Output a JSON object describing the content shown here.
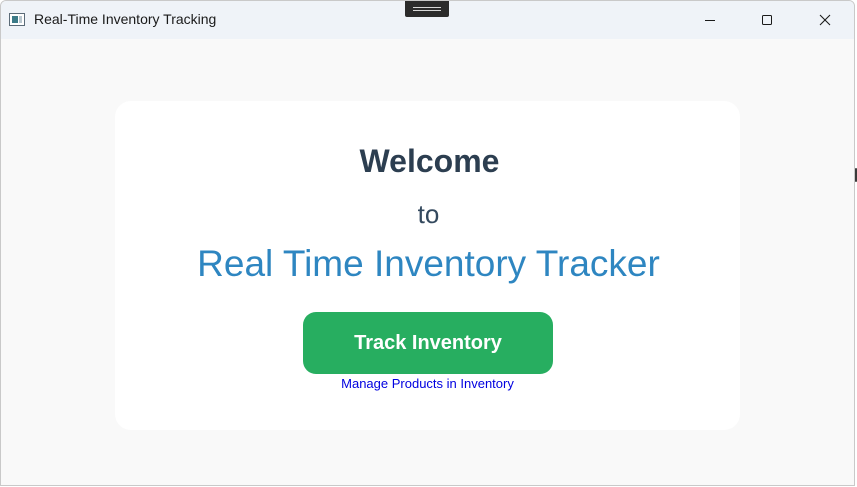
{
  "window": {
    "title": "Real-Time Inventory Tracking",
    "controls": {
      "minimize": "minimize-icon",
      "maximize": "maximize-icon",
      "close": "close-icon"
    }
  },
  "main": {
    "welcome": "Welcome",
    "to": "to",
    "app_name": "Real Time Inventory Tracker",
    "track_button_label": "Track Inventory",
    "manage_link": "Manage Products in Inventory"
  },
  "colors": {
    "heading": "#2c3e50",
    "accent_blue": "#2e86c1",
    "button_green": "#27ae60",
    "link": "#0000e0",
    "background": "#f9f9f9",
    "card": "#ffffff"
  }
}
